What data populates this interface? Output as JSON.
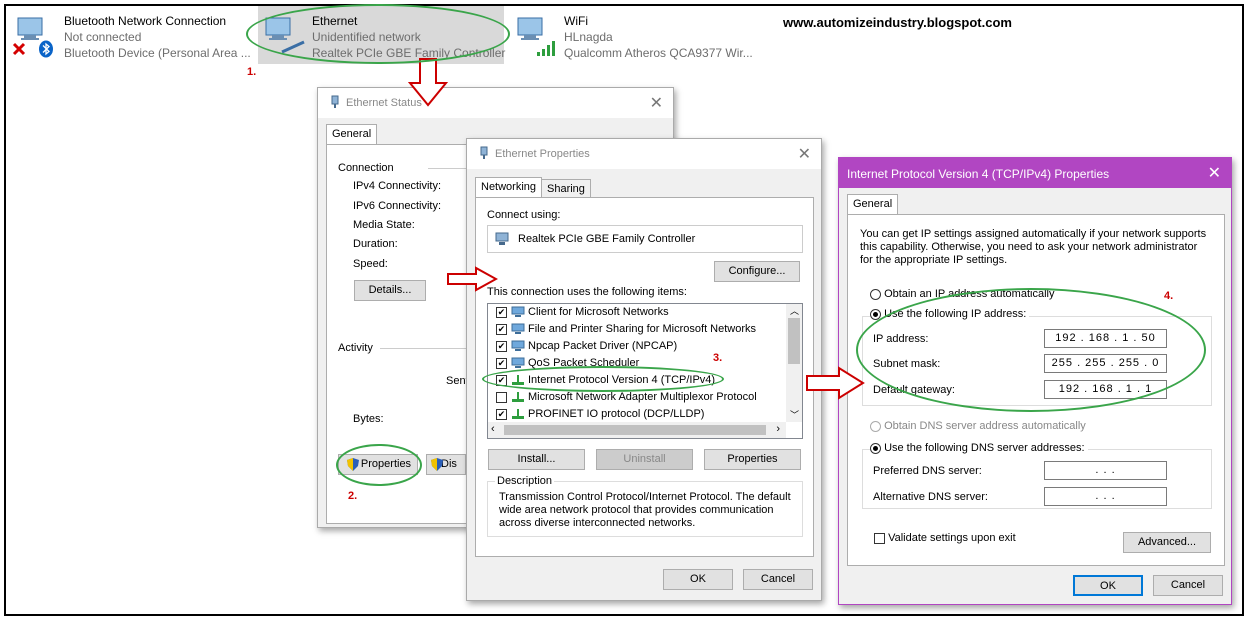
{
  "adapters": [
    {
      "name": "Bluetooth Network Connection",
      "status": "Not connected",
      "device": "Bluetooth Device (Personal Area ..."
    },
    {
      "name": "Ethernet",
      "status": "Unidentified network",
      "device": "Realtek PCIe GBE Family Controller"
    },
    {
      "name": "WiFi",
      "status": "HLnagda",
      "device": "Qualcomm Atheros QCA9377 Wir..."
    }
  ],
  "watermark": "www.automizeindustry.blogspot.com",
  "steps": [
    "1.",
    "2.",
    "3.",
    "4."
  ],
  "status_dialog": {
    "title": "Ethernet Status",
    "tab": "General",
    "connection": "Connection",
    "rows": [
      "IPv4 Connectivity:",
      "IPv6 Connectivity:",
      "Media State:",
      "Duration:",
      "Speed:"
    ],
    "details": "Details...",
    "activity": "Activity",
    "sent": "Sent",
    "bytes": "Bytes:",
    "properties": "Properties",
    "disable": "Dis"
  },
  "props_dialog": {
    "title": "Ethernet Properties",
    "tabs": [
      "Networking",
      "Sharing"
    ],
    "connect_using": "Connect using:",
    "adapter": "Realtek PCIe GBE Family Controller",
    "configure": "Configure...",
    "uses_items": "This connection uses the following items:",
    "items": [
      {
        "label": "Client for Microsoft Networks",
        "checked": true
      },
      {
        "label": "File and Printer Sharing for Microsoft Networks",
        "checked": true
      },
      {
        "label": "Npcap Packet Driver (NPCAP)",
        "checked": true
      },
      {
        "label": "QoS Packet Scheduler",
        "checked": true
      },
      {
        "label": "Internet Protocol Version 4 (TCP/IPv4)",
        "checked": true
      },
      {
        "label": "Microsoft Network Adapter Multiplexor Protocol",
        "checked": false
      },
      {
        "label": "PROFINET IO protocol (DCP/LLDP)",
        "checked": true
      }
    ],
    "install": "Install...",
    "uninstall": "Uninstall",
    "properties": "Properties",
    "description_label": "Description",
    "description": "Transmission Control Protocol/Internet Protocol. The default wide area network protocol that provides communication across diverse interconnected networks.",
    "ok": "OK",
    "cancel": "Cancel"
  },
  "ipv4_dialog": {
    "title": "Internet Protocol Version 4 (TCP/IPv4) Properties",
    "tab": "General",
    "intro": "You can get IP settings assigned automatically if your network supports this capability. Otherwise, you need to ask your network administrator for the appropriate IP settings.",
    "obtain_ip": "Obtain an IP address automatically",
    "use_ip": "Use the following IP address:",
    "ip_label": "IP address:",
    "ip_value": "192 . 168 .  1  . 50",
    "mask_label": "Subnet mask:",
    "mask_value": "255 . 255 . 255 .  0",
    "gw_label": "Default gateway:",
    "gw_value": "192 . 168 .  1  .  1",
    "obtain_dns": "Obtain DNS server address automatically",
    "use_dns": "Use the following DNS server addresses:",
    "pref_dns": "Preferred DNS server:",
    "alt_dns": "Alternative DNS server:",
    "empty_ip": ".     .     .",
    "validate": "Validate settings upon exit",
    "advanced": "Advanced...",
    "ok": "OK",
    "cancel": "Cancel"
  },
  "colors": {
    "accent": "#b146c2",
    "ellipse": "#3aa54a",
    "step": "#cc0000",
    "arrow": "#cc0000"
  }
}
